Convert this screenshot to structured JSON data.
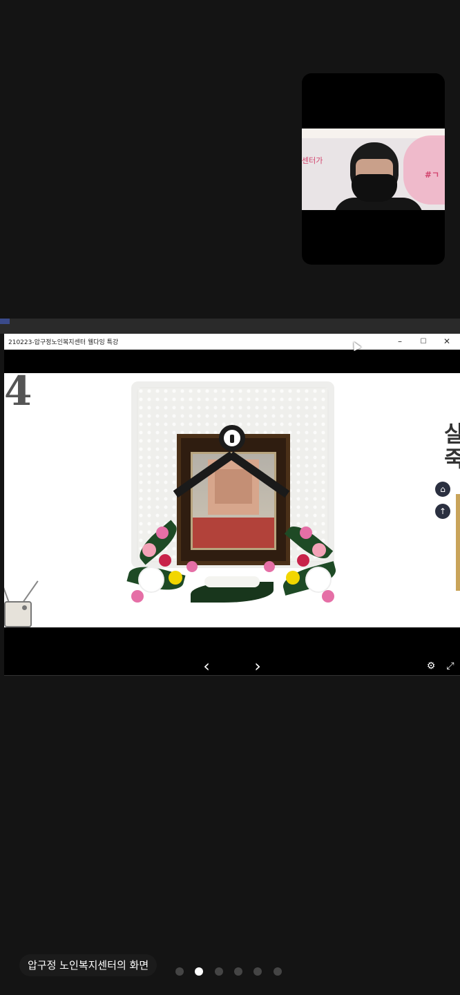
{
  "window": {
    "title": "210223-압구정노인복지센터 웰다잉 특강",
    "minimize_label": "–",
    "maximize_label": "☐",
    "close_label": "✕"
  },
  "slide": {
    "number": "4",
    "heading_line1": "살아",
    "heading_line2": "죽어",
    "nav_home_label": "⌂",
    "nav_up_label": "↑"
  },
  "video": {
    "wall_text": "센터가",
    "wall_text2": "#ㄱ"
  },
  "viewer_controls": {
    "prev_label": "‹",
    "next_label": "›",
    "settings_label": "⚙",
    "fullscreen_label": "⤢"
  },
  "caption": {
    "text": "압구정 노인복지센터의 화면"
  },
  "pagination": {
    "count": 6,
    "active_index": 1
  },
  "colors": {
    "background": "#141414",
    "nav_circle": "#2b3040",
    "accent_gold": "#c9a45a"
  }
}
